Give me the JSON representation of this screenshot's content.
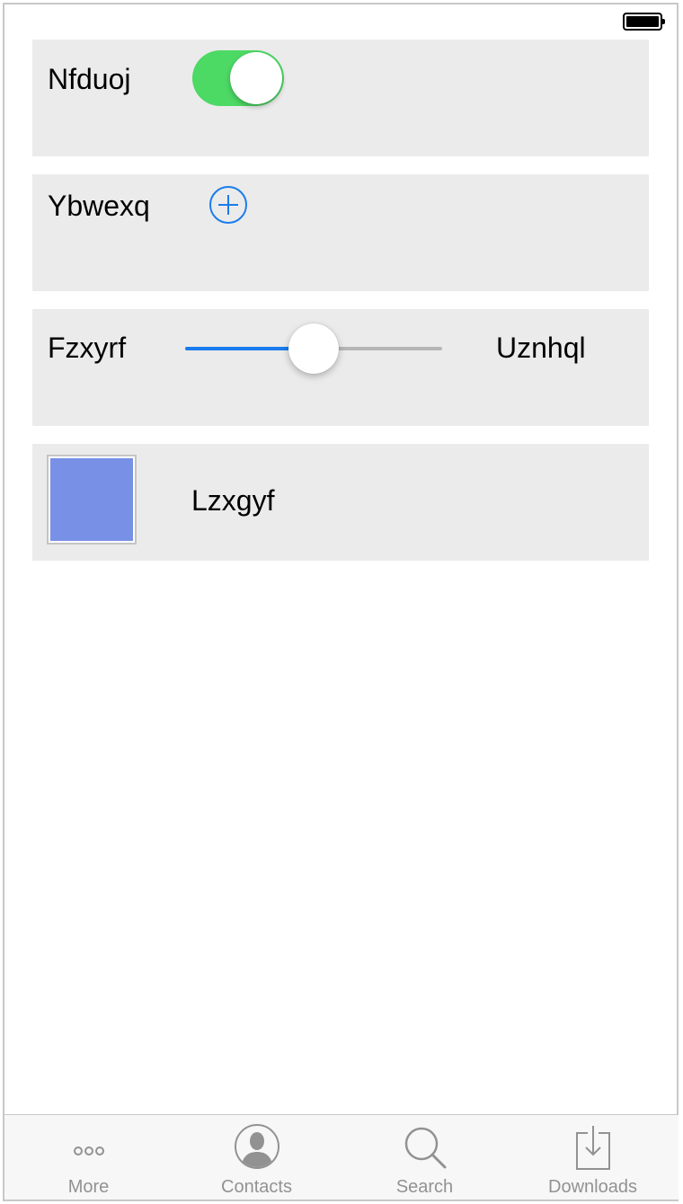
{
  "rows": [
    {
      "label": "Nfduoj",
      "control": "toggle",
      "on": true
    },
    {
      "label": "Ybwexq",
      "control": "add-button"
    },
    {
      "label": "Fzxyrf",
      "control": "slider",
      "value_fraction": 0.5,
      "end_label": "Uznhql"
    },
    {
      "label": "Lzxgyf",
      "control": "color-swatch",
      "color": "#7890e5"
    }
  ],
  "colors": {
    "toggle_on": "#4cd964",
    "accent": "#1a7cec",
    "row_background": "#ebebeb",
    "tab_inactive": "#929292"
  },
  "tabs": [
    {
      "label": "More",
      "icon": "more-icon"
    },
    {
      "label": "Contacts",
      "icon": "contacts-icon"
    },
    {
      "label": "Search",
      "icon": "search-icon"
    },
    {
      "label": "Downloads",
      "icon": "downloads-icon"
    }
  ]
}
